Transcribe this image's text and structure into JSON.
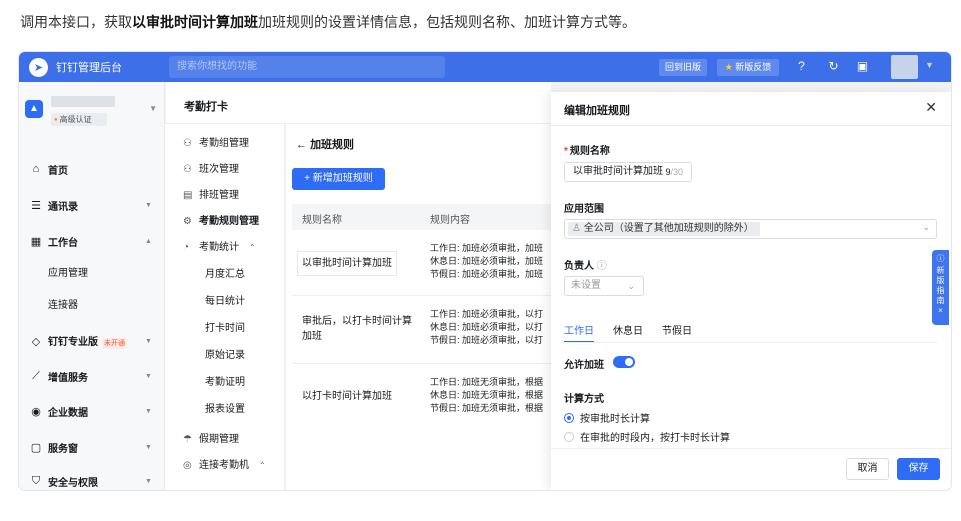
{
  "intro": {
    "before": "调用本接口，获取",
    "bold": "以审批时间计算加班",
    "after": "加班规则的设置详情信息，包括规则名称、加班计算方式等。"
  },
  "topbar": {
    "brand": "钉钉管理后台",
    "search_placeholder": "搜索你想找的功能",
    "old_version": "回到旧版",
    "feedback": "新版反馈",
    "colors": {
      "bar": "#3c6fe8"
    }
  },
  "sidebar": {
    "org_badge": "高级认证",
    "items": [
      {
        "icon": "⌂",
        "label": "首页"
      },
      {
        "icon": "☰",
        "label": "通讯录"
      },
      {
        "icon": "▦",
        "label": "工作台"
      },
      {
        "icon": "◇",
        "label": "钉钉专业版",
        "badge": "未开通"
      },
      {
        "icon": "⟋",
        "label": "增值服务"
      },
      {
        "icon": "◉",
        "label": "企业数据"
      },
      {
        "icon": "▢",
        "label": "服务窗"
      },
      {
        "icon": "⛉",
        "label": "安全与权限"
      }
    ],
    "subitems": [
      "应用管理",
      "连接器"
    ]
  },
  "section": {
    "title": "考勤打卡",
    "items": [
      "考勤组管理",
      "班次管理",
      "排班管理",
      "考勤规则管理",
      "考勤统计",
      "假期管理",
      "连接考勤机"
    ],
    "stats_sub": [
      "月度汇总",
      "每日统计",
      "打卡时间",
      "原始记录",
      "考勤证明",
      "报表设置"
    ]
  },
  "main": {
    "back_title": "加班规则",
    "new_button": "+ 新增加班规则",
    "columns": [
      "规则名称",
      "规则内容"
    ],
    "rows": [
      {
        "name": "以审批时间计算加班",
        "lines": [
          "工作日: 加班必须审批，加班",
          "休息日: 加班必须审批，加班",
          "节假日: 加班必须审批，加班"
        ]
      },
      {
        "name": "审批后，以打卡时间计算加班",
        "lines": [
          "工作日: 加班必须审批，以打",
          "休息日: 加班必须审批，以打",
          "节假日: 加班必须审批，以打"
        ]
      },
      {
        "name": "以打卡时间计算加班",
        "lines": [
          "工作日: 加班无须审批，根据",
          "休息日: 加班无须审批，根据",
          "节假日: 加班无须审批，根据"
        ]
      }
    ]
  },
  "drawer": {
    "title": "编辑加班规则",
    "name_label": "规则名称",
    "name_value": "以审批时间计算加班",
    "name_count": "9",
    "name_max": "/30",
    "scope_label": "应用范围",
    "scope_value": "全公司（设置了其他加班规则的除外）",
    "owner_label": "负责人",
    "owner_placeholder": "未设置",
    "tabs": [
      "工作日",
      "休息日",
      "节假日"
    ],
    "allow_label": "允许加班",
    "calc_label": "计算方式",
    "calc_options": [
      "按审批时长计算",
      "在审批的时段内，按打卡时长计算"
    ],
    "cancel": "取消",
    "save": "保存"
  },
  "guide": "新版指南"
}
